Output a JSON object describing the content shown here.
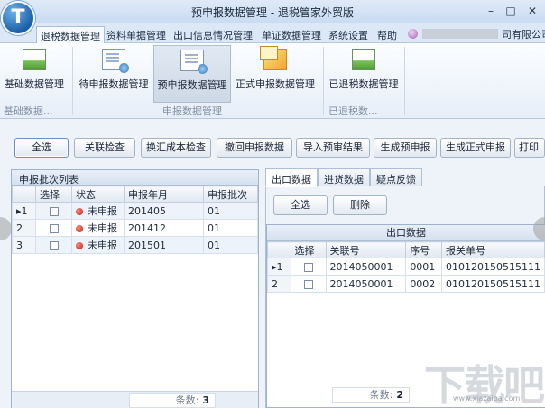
{
  "window": {
    "title": "预申报数据管理 - 退税管家外贸版",
    "logo_letter": "T",
    "minimize": "–",
    "maximize": "□",
    "close": "✕"
  },
  "menu_tabs": [
    "退税数据管理",
    "资料单据管理",
    "出口信息情况管理",
    "单证数据管理",
    "系统设置",
    "帮助"
  ],
  "user": {
    "company_suffix": "司有限公司"
  },
  "ribbon": {
    "buttons": [
      {
        "label": "基础数据管理",
        "icon": "green-board-icon"
      },
      {
        "label": "待申报数据管理",
        "icon": "document-gear-icon"
      },
      {
        "label": "预申报数据管理",
        "icon": "document-gear-icon"
      },
      {
        "label": "正式申报数据管理",
        "icon": "stacked-documents-icon"
      },
      {
        "label": "已退税数据管理",
        "icon": "green-board-icon"
      }
    ],
    "groups": [
      "基础数据...",
      "申报数据管理",
      "已退税数..."
    ]
  },
  "toolbar": [
    "全选",
    "关联检查",
    "换汇成本检查",
    "撤回申报数据",
    "导入预审结果",
    "生成预申报",
    "生成正式申报",
    "打印"
  ],
  "left_panel": {
    "title": "申报批次列表",
    "columns": [
      "选择",
      "状态",
      "申报年月",
      "申报批次"
    ],
    "rows": [
      {
        "row": "1",
        "status": "未申报",
        "month": "201405",
        "batch": "01"
      },
      {
        "row": "2",
        "status": "未申报",
        "month": "201412",
        "batch": "01"
      },
      {
        "row": "3",
        "status": "未申报",
        "month": "201501",
        "batch": "01"
      }
    ],
    "count_label": "条数:",
    "count_value": "3"
  },
  "right_panel": {
    "tabs": [
      "出口数据",
      "进货数据",
      "疑点反馈"
    ],
    "buttons": [
      "全选",
      "删除"
    ],
    "grid_title": "出口数据",
    "columns": [
      "选择",
      "关联号",
      "序号",
      "报关单号"
    ],
    "rows": [
      {
        "row": "1",
        "link": "2014050001",
        "seq": "0001",
        "customs": "010120150515111"
      },
      {
        "row": "2",
        "link": "2014050001",
        "seq": "0002",
        "customs": "010120150515111"
      }
    ],
    "count_label": "条数:",
    "count_value": "2"
  },
  "watermark": {
    "text": "下载吧",
    "sub": "www.xiazaiba.com"
  }
}
